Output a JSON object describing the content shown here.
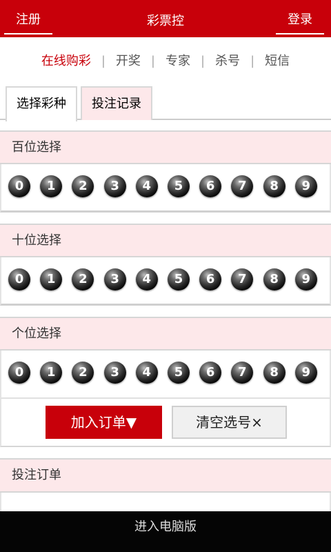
{
  "header": {
    "title": "彩票控",
    "register": "注册",
    "login": "登录",
    "accent_color": "#c8000a"
  },
  "nav": {
    "items": [
      "在线购彩",
      "开奖",
      "专家",
      "杀号",
      "短信"
    ],
    "active": "在线购彩"
  },
  "tabs": [
    "选择彩种",
    "投注记录"
  ],
  "sections": [
    {
      "title": "百位选择",
      "numbers": [
        "0",
        "1",
        "2",
        "3",
        "4",
        "5",
        "6",
        "7",
        "8",
        "9"
      ]
    },
    {
      "title": "十位选择",
      "numbers": [
        "0",
        "1",
        "2",
        "3",
        "4",
        "5",
        "6",
        "7",
        "8",
        "9"
      ]
    },
    {
      "title": "个位选择",
      "numbers": [
        "0",
        "1",
        "2",
        "3",
        "4",
        "5",
        "6",
        "7",
        "8",
        "9"
      ]
    }
  ],
  "actions": {
    "add_order": "加入订单▼",
    "clear": "清空选号×"
  },
  "order": {
    "title": "投注订单"
  },
  "footer": {
    "label": "进入电脑版"
  }
}
